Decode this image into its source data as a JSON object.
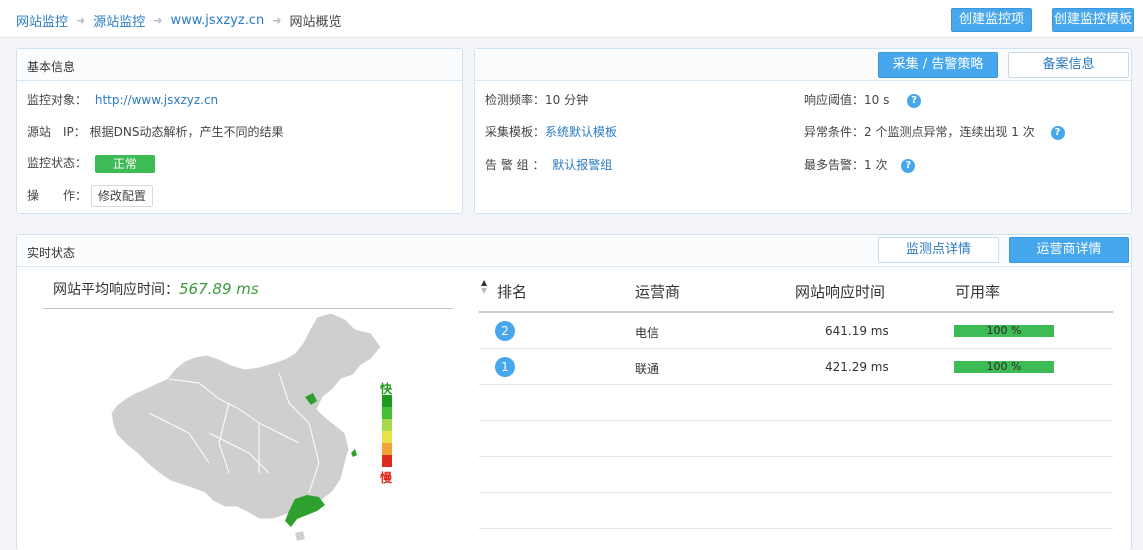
{
  "breadcrumb": {
    "items": [
      "网站监控",
      "源站监控",
      "www.jsxzyz.cn"
    ],
    "current": "网站概览"
  },
  "toolbar": {
    "create_item": "创建监控项",
    "create_template": "创建监控模板"
  },
  "basic": {
    "title": "基本信息",
    "target_label": "监控对象：",
    "target_value": "http://www.jsxzyz.cn",
    "ip_label": "源站　IP：",
    "ip_value": "根据DNS动态解析，产生不同的结果",
    "status_label": "监控状态：",
    "status_value": "正常",
    "op_label": "操　　作：",
    "op_button": "修改配置"
  },
  "detect": {
    "btn_policy": "采集 / 告警策略",
    "btn_record": "备案信息",
    "freq_label": "检测频率：",
    "freq_value": "10 分钟",
    "tpl_label": "采集模板：",
    "tpl_value": "系统默认模板",
    "alarm_label": "告 警 组 ：",
    "alarm_value": "默认报警组",
    "threshold_label": "响应阈值：",
    "threshold_value": "10 s",
    "cond_label": "异常条件：",
    "cond_value": "2 个监测点异常，连续出现 1 次",
    "max_label": "最多告警：",
    "max_value": "1 次",
    "help_glyph": "?"
  },
  "realtime": {
    "title": "实时状态",
    "btn_points": "监测点详情",
    "btn_isp": "运营商详情",
    "avg_label": "网站平均响应时间：",
    "avg_value": "567.89 ms",
    "legend_fast": "快",
    "legend_slow": "慢",
    "legend_colors": [
      "#1e9b1e",
      "#43bf33",
      "#a6d94e",
      "#e6e34a",
      "#f0a33a",
      "#dd2b1d"
    ],
    "columns": [
      "排名",
      "运营商",
      "网站响应时间",
      "可用率"
    ],
    "rows": [
      {
        "rank": "2",
        "isp": "电信",
        "time": "641.19 ms",
        "avail": "100 %"
      },
      {
        "rank": "1",
        "isp": "联通",
        "time": "421.29 ms",
        "avail": "100 %"
      }
    ]
  },
  "colors": {
    "accent": "#47a7ec",
    "link": "#2b7bc3",
    "ok": "#3dbb55"
  }
}
